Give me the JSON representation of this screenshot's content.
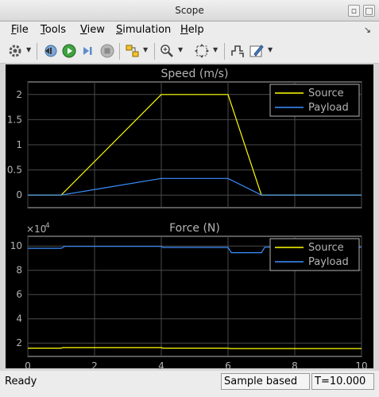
{
  "window": {
    "title": "Scope"
  },
  "menu": [
    {
      "label": "File",
      "ul": "F",
      "rest": "ile"
    },
    {
      "label": "Tools",
      "ul": "T",
      "rest": "ools"
    },
    {
      "label": "View",
      "ul": "V",
      "rest": "iew"
    },
    {
      "label": "Simulation",
      "ul": "S",
      "rest": "imulation"
    },
    {
      "label": "Help",
      "ul": "H",
      "rest": "elp"
    }
  ],
  "toolbar": {
    "icons": [
      "gear-icon",
      "step-back-icon",
      "run-icon",
      "step-forward-icon",
      "stop-icon",
      "highlight-block-icon",
      "zoom-icon",
      "fit-to-view-icon",
      "cursor-measure-icon",
      "style-icon"
    ]
  },
  "colors": {
    "source": "#ffff00",
    "payload": "#3c8fff",
    "axes_bg": "#000000",
    "axes_fg": "#b4b4b4",
    "grid": "#4a4a4a"
  },
  "chart_data": [
    {
      "type": "line",
      "title": "Speed (m/s)",
      "xlim": [
        0,
        10
      ],
      "ylim": [
        -0.25,
        2.25
      ],
      "xticks": [
        0,
        2,
        4,
        6,
        8,
        10
      ],
      "yticks": [
        0,
        0.5,
        1,
        1.5,
        2
      ],
      "ytick_labels": [
        "0",
        "0.5",
        "1",
        "1.5",
        "2"
      ],
      "show_xtick_labels": false,
      "grid": true,
      "legend": "top-right",
      "series": [
        {
          "name": "Source",
          "color": "#ffff00",
          "x": [
            0,
            1,
            4,
            6,
            7,
            10
          ],
          "y": [
            0,
            0,
            2,
            2,
            0,
            0
          ]
        },
        {
          "name": "Payload",
          "color": "#3c8fff",
          "x": [
            0,
            1,
            4,
            6,
            7,
            10
          ],
          "y": [
            0,
            0,
            0.33,
            0.33,
            0,
            0
          ]
        }
      ]
    },
    {
      "type": "line",
      "title": "Force (N)",
      "exponent_label": "×10",
      "exponent_power": "4",
      "xlim": [
        0,
        10
      ],
      "ylim": [
        0.9,
        10.8
      ],
      "xticks": [
        0,
        2,
        4,
        6,
        8,
        10
      ],
      "xtick_labels": [
        "0",
        "2",
        "4",
        "6",
        "8",
        "10"
      ],
      "yticks": [
        2,
        4,
        6,
        8,
        10
      ],
      "ytick_labels": [
        "2",
        "4",
        "6",
        "8",
        "10"
      ],
      "grid": true,
      "legend": "top-right",
      "series": [
        {
          "name": "Source",
          "color": "#ffff00",
          "x": [
            0,
            1,
            1.05,
            4,
            4.05,
            6,
            6.05,
            10
          ],
          "y": [
            1.58,
            1.58,
            1.63,
            1.63,
            1.58,
            1.58,
            1.55,
            1.55
          ]
        },
        {
          "name": "Payload",
          "color": "#3c8fff",
          "x": [
            0,
            1,
            1.1,
            4,
            4.05,
            6,
            6.1,
            7,
            7.1,
            10
          ],
          "y": [
            9.81,
            9.81,
            9.97,
            9.97,
            9.88,
            9.88,
            9.45,
            9.45,
            9.9,
            9.9
          ]
        }
      ]
    }
  ],
  "status": {
    "state": "Ready",
    "mode": "Sample based",
    "time": "T=10.000"
  }
}
